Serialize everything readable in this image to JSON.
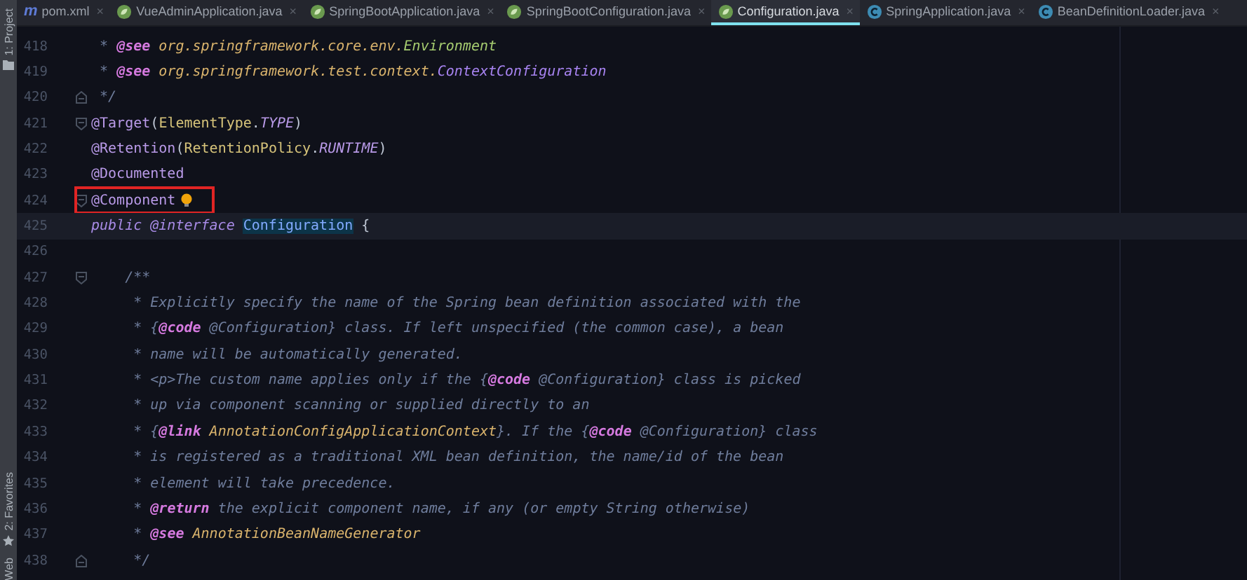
{
  "tool_strip": {
    "top": [
      {
        "label": "1: Project",
        "kind": "folder"
      }
    ],
    "bottom": [
      {
        "label": "2: Favorites",
        "kind": "star"
      },
      {
        "label": "Web",
        "kind": "plain"
      }
    ]
  },
  "tabs": [
    {
      "label": "pom.xml",
      "kind": "maven",
      "glyph": "m",
      "close": "×",
      "selected": false
    },
    {
      "label": "VueAdminApplication.java",
      "kind": "spring",
      "close": "×",
      "selected": false
    },
    {
      "label": "SpringBootApplication.java",
      "kind": "spring",
      "close": "×",
      "selected": false
    },
    {
      "label": "SpringBootConfiguration.java",
      "kind": "spring",
      "close": "×",
      "selected": false
    },
    {
      "label": "Configuration.java",
      "kind": "spring",
      "close": "×",
      "selected": true
    },
    {
      "label": "SpringApplication.java",
      "kind": "class",
      "close": "×",
      "selected": false
    },
    {
      "label": "BeanDefinitionLoader.java",
      "kind": "class",
      "close": "×",
      "selected": false
    }
  ],
  "editor": {
    "lines": [
      {
        "number": "418",
        "current": false,
        "tokens": [
          {
            "text": " * ",
            "kind": "comment"
          },
          {
            "text": "@see",
            "kind": "doc-tag"
          },
          {
            "text": " org.springframework.core.env.",
            "kind": "package"
          },
          {
            "text": "Environment",
            "kind": "class"
          }
        ]
      },
      {
        "number": "419",
        "current": false,
        "tokens": [
          {
            "text": " * ",
            "kind": "comment"
          },
          {
            "text": "@see",
            "kind": "doc-tag"
          },
          {
            "text": " org.springframework.test.context.",
            "kind": "package"
          },
          {
            "text": "ContextConfiguration",
            "kind": "ref"
          }
        ]
      },
      {
        "number": "420",
        "current": false,
        "fold": {
          "kind": "end"
        },
        "tokens": [
          {
            "text": " */",
            "kind": "comment"
          }
        ]
      },
      {
        "number": "421",
        "current": false,
        "fold": {
          "kind": "start"
        },
        "tokens": [
          {
            "text": "@Target",
            "kind": "annotation"
          },
          {
            "text": "(",
            "kind": "plain"
          },
          {
            "text": "ElementType",
            "kind": "type"
          },
          {
            "text": ".",
            "kind": "plain"
          },
          {
            "text": "TYPE",
            "kind": "constant"
          },
          {
            "text": ")",
            "kind": "plain"
          }
        ]
      },
      {
        "number": "422",
        "current": false,
        "tokens": [
          {
            "text": "@Retention",
            "kind": "annotation"
          },
          {
            "text": "(",
            "kind": "plain"
          },
          {
            "text": "RetentionPolicy",
            "kind": "type"
          },
          {
            "text": ".",
            "kind": "plain"
          },
          {
            "text": "RUNTIME",
            "kind": "constant"
          },
          {
            "text": ")",
            "kind": "plain"
          }
        ]
      },
      {
        "number": "423",
        "current": false,
        "tokens": [
          {
            "text": "@Documented",
            "kind": "annotation"
          }
        ]
      },
      {
        "number": "424",
        "current": false,
        "fold": {
          "kind": "start"
        },
        "boxed": true,
        "bulb": true,
        "tokens": [
          {
            "text": "@Component",
            "kind": "annotation"
          }
        ]
      },
      {
        "number": "425",
        "current": true,
        "tokens": [
          {
            "text": "public @interface ",
            "kind": "keyword"
          },
          {
            "text": "Configuration",
            "kind": "declaration"
          },
          {
            "text": " {",
            "kind": "plain"
          }
        ]
      },
      {
        "number": "426",
        "current": false
      },
      {
        "number": "427",
        "current": false,
        "fold": {
          "kind": "start"
        },
        "tokens": [
          {
            "text": "    /**",
            "kind": "comment"
          }
        ]
      },
      {
        "number": "428",
        "current": false,
        "tokens": [
          {
            "text": "     * Explicitly specify the name of the Spring bean definition associated with the",
            "kind": "comment"
          }
        ]
      },
      {
        "number": "429",
        "current": false,
        "tokens": [
          {
            "text": "     * {",
            "kind": "comment"
          },
          {
            "text": "@code",
            "kind": "doc-tag"
          },
          {
            "text": " @Configuration} class. If left unspecified (the common case), a bean",
            "kind": "comment"
          }
        ]
      },
      {
        "number": "430",
        "current": false,
        "tokens": [
          {
            "text": "     * name will be automatically generated.",
            "kind": "comment"
          }
        ]
      },
      {
        "number": "431",
        "current": false,
        "tokens": [
          {
            "text": "     * <p>The custom name applies only if the {",
            "kind": "comment"
          },
          {
            "text": "@code",
            "kind": "doc-tag"
          },
          {
            "text": " @Configuration} class is picked",
            "kind": "comment"
          }
        ]
      },
      {
        "number": "432",
        "current": false,
        "tokens": [
          {
            "text": "     * up via component scanning or supplied directly to an",
            "kind": "comment"
          }
        ]
      },
      {
        "number": "433",
        "current": false,
        "tokens": [
          {
            "text": "     * {",
            "kind": "comment"
          },
          {
            "text": "@link",
            "kind": "doc-tag"
          },
          {
            "text": " AnnotationConfigApplicationContext",
            "kind": "package"
          },
          {
            "text": "}. If the {",
            "kind": "comment"
          },
          {
            "text": "@code",
            "kind": "doc-tag"
          },
          {
            "text": " @Configuration} class",
            "kind": "comment"
          }
        ]
      },
      {
        "number": "434",
        "current": false,
        "tokens": [
          {
            "text": "     * is registered as a traditional XML bean definition, the name/id of the bean",
            "kind": "comment"
          }
        ]
      },
      {
        "number": "435",
        "current": false,
        "tokens": [
          {
            "text": "     * element will take precedence.",
            "kind": "comment"
          }
        ]
      },
      {
        "number": "436",
        "current": false,
        "tokens": [
          {
            "text": "     * ",
            "kind": "comment"
          },
          {
            "text": "@return",
            "kind": "doc-tag"
          },
          {
            "text": " the explicit component name, if any (or empty String otherwise)",
            "kind": "comment"
          }
        ]
      },
      {
        "number": "437",
        "current": false,
        "tokens": [
          {
            "text": "     * ",
            "kind": "comment"
          },
          {
            "text": "@see",
            "kind": "doc-tag"
          },
          {
            "text": " AnnotationBeanNameGenerator",
            "kind": "package"
          }
        ]
      },
      {
        "number": "438",
        "current": false,
        "fold": {
          "kind": "end"
        },
        "tokens": [
          {
            "text": "     */",
            "kind": "comment"
          }
        ]
      }
    ]
  }
}
